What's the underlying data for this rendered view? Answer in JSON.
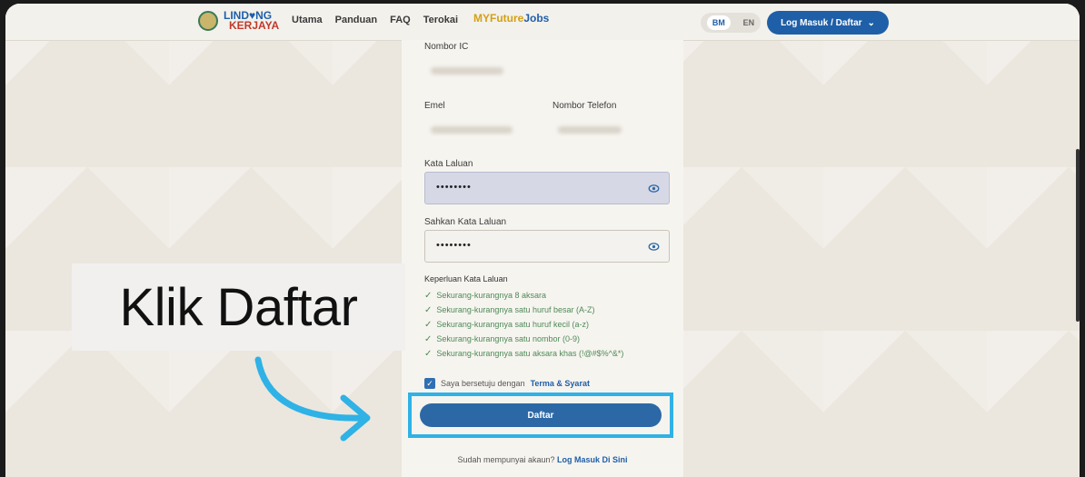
{
  "nav": {
    "logo_line1": "LIND♥NG",
    "logo_line2": "KERJAYA",
    "links": [
      "Utama",
      "Panduan",
      "FAQ",
      "Terokai"
    ],
    "mfj_a": "MYFuture",
    "mfj_b": "Jobs",
    "lang_bm": "BM",
    "lang_en": "EN",
    "login_label": "Log Masuk / Daftar",
    "login_caret": "⌄"
  },
  "form": {
    "ic_label": "Nombor IC",
    "email_label": "Emel",
    "phone_label": "Nombor Telefon",
    "password_label": "Kata Laluan",
    "password_value": "••••••••",
    "confirm_label": "Sahkan Kata Laluan",
    "confirm_value": "••••••••",
    "req_title": "Keperluan Kata Laluan",
    "requirements": [
      "Sekurang-kurangnya 8 aksara",
      "Sekurang-kurangnya satu huruf besar (A-Z)",
      "Sekurang-kurangnya satu huruf kecil (a-z)",
      "Sekurang-kurangnya satu nombor (0-9)",
      "Sekurang-kurangnya satu aksara khas (!@#$%^&*)"
    ],
    "agree_text": "Saya bersetuju dengan",
    "agree_link": "Terma & Syarat",
    "submit_label": "Daftar",
    "have_account": "Sudah mempunyai akaun?",
    "login_here": "Log Masuk Di Sini"
  },
  "overlay": {
    "instruction": "Klik Daftar"
  },
  "colors": {
    "primary": "#2c68a6",
    "highlight": "#2fb2e6",
    "check": "#4e8a58"
  }
}
